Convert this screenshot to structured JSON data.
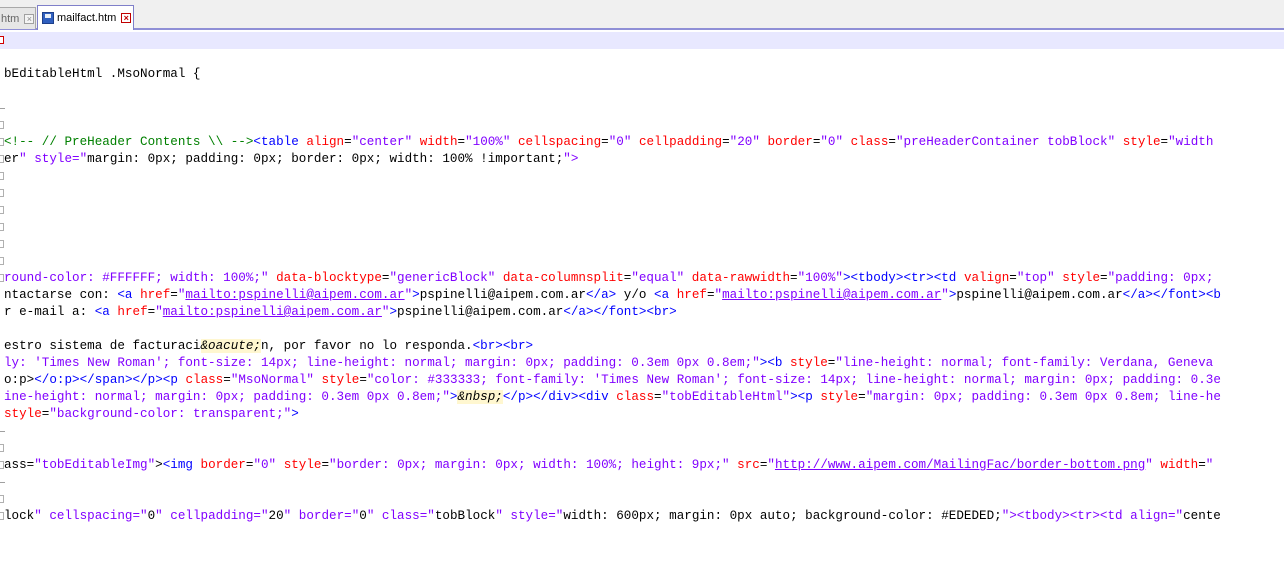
{
  "tabs": [
    {
      "label": "htm",
      "active": false
    },
    {
      "label": "mailfact.htm",
      "active": true
    }
  ],
  "lines": [
    {
      "text": "",
      "current": true,
      "marker": "fold-red"
    },
    {
      "text": "",
      "marker": "line"
    },
    {
      "text": "bEditableHtml .MsoNormal {",
      "marker": "line"
    },
    {
      "text": "",
      "marker": "line"
    },
    {
      "text": "",
      "marker": "tick"
    },
    {
      "text": "",
      "marker": "fold"
    },
    {
      "text": "<!-- // PreHeader Contents \\\\ --><table align=\"center\" width=\"100%\" cellspacing=\"0\" cellpadding=\"20\" border=\"0\" class=\"preHeaderContainer tobBlock\" style=\"width",
      "marker": "fold"
    },
    {
      "text": "er\" style=\"margin: 0px; padding: 0px; border: 0px; width: 100% !important;\">",
      "marker": "fold"
    },
    {
      "text": "",
      "marker": "fold"
    },
    {
      "text": "",
      "marker": "fold"
    },
    {
      "text": "",
      "marker": "fold"
    },
    {
      "text": "",
      "marker": "fold"
    },
    {
      "text": "",
      "marker": "fold"
    },
    {
      "text": "",
      "marker": "fold"
    },
    {
      "text": "round-color: #FFFFFF; width: 100%;\" data-blocktype=\"genericBlock\" data-columnsplit=\"equal\" data-rawwidth=\"100%\"><tbody><tr><td valign=\"top\" style=\"padding: 0px;",
      "marker": "fold"
    },
    {
      "text": "ntactarse con: <a href=\"mailto:pspinelli@aipem.com.ar\">pspinelli@aipem.com.ar</a> y/o <a href=\"mailto:pspinelli@aipem.com.ar\">pspinelli@aipem.com.ar</a></font><b",
      "marker": "line"
    },
    {
      "text": "r e-mail a: <a href=\"mailto:pspinelli@aipem.com.ar\">pspinelli@aipem.com.ar</a></font><br>",
      "marker": "line"
    },
    {
      "text": "",
      "marker": "line"
    },
    {
      "text": "estro sistema de facturaci&oacute;n, por favor no lo responda.<br><br>",
      "marker": "line"
    },
    {
      "text": "ly: 'Times New Roman'; font-size: 14px; line-height: normal; margin: 0px; padding: 0.3em 0px 0.8em;\"><b style=\"line-height: normal; font-family: Verdana, Geneva",
      "marker": "line"
    },
    {
      "text": "o:p></o:p></span></p><p class=\"MsoNormal\" style=\"color: #333333; font-family: 'Times New Roman'; font-size: 14px; line-height: normal; margin: 0px; padding: 0.3e",
      "marker": "line"
    },
    {
      "text": "ine-height: normal; margin: 0px; padding: 0.3em 0px 0.8em;\">&nbsp;</p></div><div class=\"tobEditableHtml\"><p style=\"margin: 0px; padding: 0.3em 0px 0.8em; line-he",
      "marker": "line"
    },
    {
      "text": "style=\"background-color: transparent;\">",
      "marker": "line"
    },
    {
      "text": "",
      "marker": "tick"
    },
    {
      "text": "",
      "marker": "fold"
    },
    {
      "text": "ass=\"tobEditableImg\"><img border=\"0\" style=\"border: 0px; margin: 0px; width: 100%; height: 9px;\" src=\"http://www.aipem.com/MailingFac/border-bottom.png\" width=\"",
      "marker": "fold"
    },
    {
      "text": "",
      "marker": "tick"
    },
    {
      "text": "",
      "marker": "fold"
    },
    {
      "text": "lock\" cellspacing=\"0\" cellpadding=\"20\" border=\"0\" class=\"tobBlock\" style=\"width: 600px; margin: 0px auto; background-color: #EDEDED;\"><tbody><tr><td align=\"cente",
      "marker": "fold"
    },
    {
      "text": "",
      "marker": "line"
    },
    {
      "text": "",
      "marker": "line"
    }
  ],
  "colors": {
    "tag": "#0000ff",
    "attr": "#ff0000",
    "value": "#8000ff",
    "comment": "#008000",
    "entity": "#000000",
    "current_line": "#e8e8ff",
    "tab_underline": "#8f8fd6"
  }
}
